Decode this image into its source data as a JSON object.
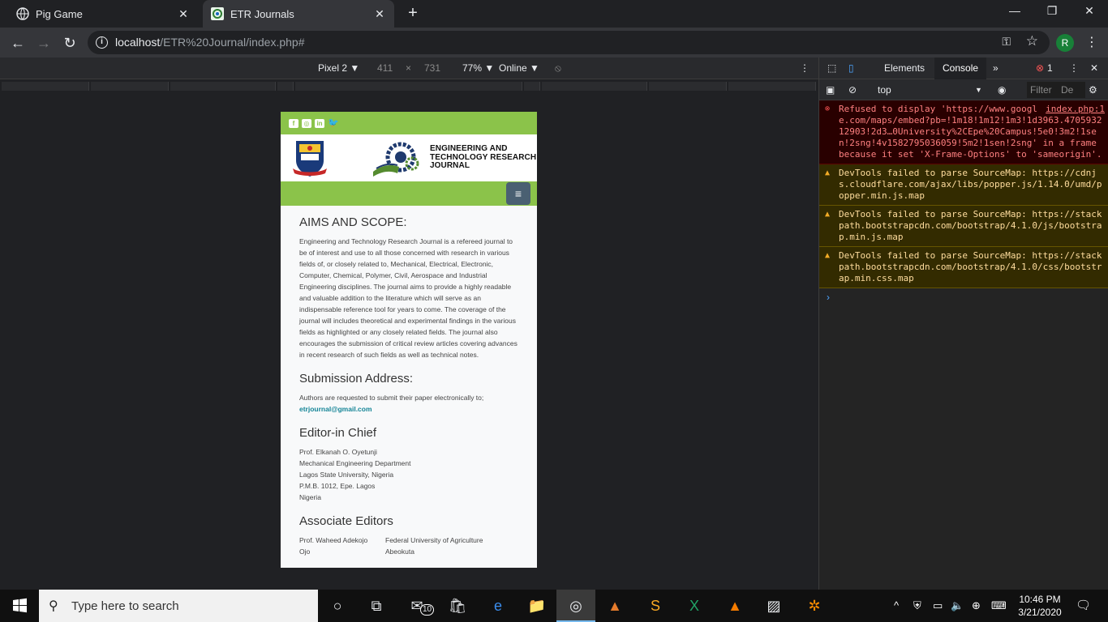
{
  "browser": {
    "tabs": [
      {
        "title": "Pig Game",
        "close": "✕"
      },
      {
        "title": "ETR Journals",
        "close": "✕"
      }
    ],
    "new_tab": "+",
    "window_controls": {
      "minimize": "—",
      "restore": "❐",
      "close": "✕"
    },
    "url_host": "localhost",
    "url_path": "/ETR%20Journal/index.php#",
    "profile_initial": "R"
  },
  "device_toolbar": {
    "device": "Pixel 2 ▼",
    "width": "411",
    "times": "×",
    "height": "731",
    "zoom": "77% ▼",
    "throttle": "Online ▼"
  },
  "page": {
    "banner_title_lines": [
      "ENGINEERING AND",
      "TECHNOLOGY RESEARCH",
      "JOURNAL"
    ],
    "aims_title": "AIMS AND SCOPE:",
    "aims_text": "Engineering and Technology Research Journal is a refereed journal to be of interest and use to all those concerned with research in various fields of, or closely related to, Mechanical, Electrical, Electronic, Computer, Chemical, Polymer, Civil, Aerospace and Industrial Engineering disciplines. The journal aims to provide a highly readable and valuable addition to the literature which will serve as an indispensable reference tool for years to come. The coverage of the journal will includes theoretical and experimental findings in the various fields as highlighted or any closely related fields. The journal also encourages the submission of critical review articles covering advances in recent research of such fields as well as technical notes.",
    "submission_title": "Submission Address:",
    "submission_text": "Authors are requested to submit their paper electronically to;",
    "submission_email": "etrjournal@gmail.com",
    "editor_title": "Editor-in Chief",
    "editor_lines": [
      "Prof. Elkanah O. Oyetunji",
      "Mechanical Engineering Department",
      "Lagos State University, Nigeria",
      "P.M.B. 1012, Epe. Lagos",
      "Nigeria"
    ],
    "associate_title": "Associate Editors",
    "associates": [
      {
        "name": "Prof. Waheed Adekojo",
        "affiliation": "Federal University of Agriculture"
      },
      {
        "name": "Ojo",
        "affiliation": "Abeokuta"
      }
    ]
  },
  "devtools": {
    "tab_elements": "Elements",
    "tab_console": "Console",
    "more_tabs": "»",
    "error_count": "1",
    "context": "top",
    "context_arrow": "▼",
    "filter_placeholder": "Filter",
    "levels": "De",
    "messages": [
      {
        "level": "error",
        "text": "Refused to display 'https://www.google.com/maps/embed?pb=!1m18!1m12!1m3!1d3963.470593212903!2d3…0University%2CEpe%20Campus!5e0!3m2!1sen!2sng!4v1582795036059!5m2!1sen!2sng' in a frame because it set 'X-Frame-Options' to 'sameorigin'.",
        "source": "index.php:1"
      },
      {
        "level": "warning",
        "text": "DevTools failed to parse SourceMap: https://cdnjs.cloudflare.com/ajax/libs/popper.js/1.14.0/umd/popper.min.js.map"
      },
      {
        "level": "warning",
        "text": "DevTools failed to parse SourceMap: https://stackpath.bootstrapcdn.com/bootstrap/4.1.0/js/bootstrap.min.js.map"
      },
      {
        "level": "warning",
        "text": "DevTools failed to parse SourceMap: https://stackpath.bootstrapcdn.com/bootstrap/4.1.0/css/bootstrap.min.css.map"
      }
    ],
    "prompt": "›"
  },
  "taskbar": {
    "search_placeholder": "Type here to search",
    "mail_badge": "10",
    "time": "10:46 PM",
    "date": "3/21/2020"
  }
}
